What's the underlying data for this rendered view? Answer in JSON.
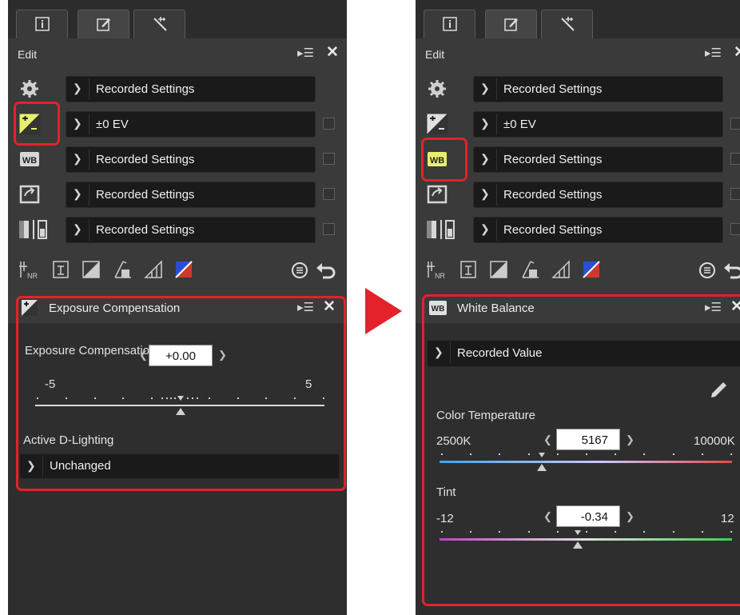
{
  "left": {
    "header": {
      "title": "Edit"
    },
    "rows": [
      {
        "value": "Recorded Settings"
      },
      {
        "value": "±0 EV"
      },
      {
        "value": "Recorded Settings"
      },
      {
        "value": "Recorded Settings"
      },
      {
        "value": "Recorded Settings"
      }
    ],
    "sub": {
      "title": "Exposure Compensation",
      "section_label": "Exposure Compensation",
      "min": "-5",
      "max": "5",
      "value": "+0.00",
      "adl_label": "Active D-Lighting",
      "adl_value": "Unchanged"
    }
  },
  "right": {
    "header": {
      "title": "Edit"
    },
    "rows": [
      {
        "value": "Recorded Settings"
      },
      {
        "value": "±0 EV"
      },
      {
        "value": "Recorded Settings"
      },
      {
        "value": "Recorded Settings"
      },
      {
        "value": "Recorded Settings"
      }
    ],
    "sub": {
      "title": "White Balance",
      "preset": "Recorded Value",
      "temp_label": "Color Temperature",
      "temp_min": "2500K",
      "temp_max": "10000K",
      "temp_value": "5167",
      "tint_label": "Tint",
      "tint_min": "-12",
      "tint_max": "12",
      "tint_value": "-0.34"
    }
  },
  "colors": {
    "highlight": "#e3222b",
    "active_icon": "#e8f06a",
    "panel_bg": "#3a3a3a"
  },
  "icons": [
    "info-icon",
    "edit-icon",
    "wand-icon",
    "menu-icon",
    "close-icon",
    "gear-icon",
    "exposure-icon",
    "wb-icon",
    "picture-control-icon",
    "tone-icon",
    "eyedropper-icon",
    "arrow-right-icon"
  ]
}
